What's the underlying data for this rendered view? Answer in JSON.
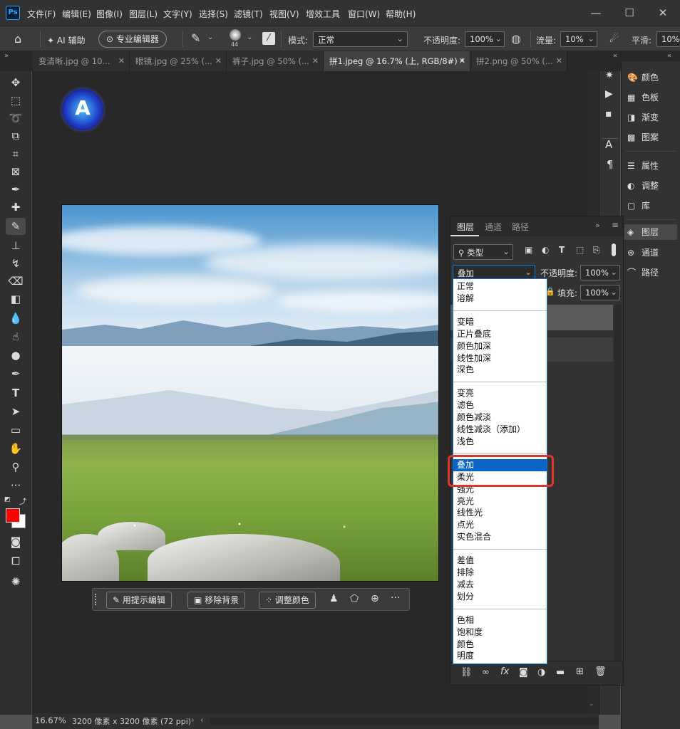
{
  "app": {
    "logo": "Ps"
  },
  "menu": [
    "文件(F)",
    "编辑(E)",
    "图像(I)",
    "图层(L)",
    "文字(Y)",
    "选择(S)",
    "滤镜(T)",
    "视图(V)",
    "增效工具",
    "窗口(W)",
    "帮助(H)"
  ],
  "window_controls": {
    "minimize": "—",
    "maximize": "☐",
    "close": "✕"
  },
  "options": {
    "ai_label": "AI 辅助",
    "pro_editor_label": "专业编辑器",
    "brush_size": "44",
    "mode_label": "模式:",
    "mode_value": "正常",
    "opacity_label": "不透明度:",
    "opacity_value": "100%",
    "flow_label": "流量:",
    "flow_value": "10%",
    "smooth_label": "平滑:",
    "smooth_value": "10%"
  },
  "tabs": [
    {
      "label": "变清晰.jpg @ 10..."
    },
    {
      "label": "眼镜.jpg @ 25% (..."
    },
    {
      "label": "裤子.jpg @ 50% (..."
    },
    {
      "label": "拼1.jpeg @ 16.7% (上, RGB/8#) *"
    },
    {
      "label": "拼2.png @ 50% (..."
    }
  ],
  "right_panels": [
    {
      "icon": "palette-icon",
      "label": "颜色"
    },
    {
      "icon": "grid-icon",
      "label": "色板"
    },
    {
      "icon": "gradient-icon",
      "label": "渐变"
    },
    {
      "icon": "pattern-icon",
      "label": "图案"
    },
    {
      "icon": "sliders-icon",
      "label": "属性"
    },
    {
      "icon": "adjust-icon",
      "label": "调整"
    },
    {
      "icon": "library-icon",
      "label": "库"
    },
    {
      "icon": "layers-icon",
      "label": "图层"
    },
    {
      "icon": "channels-icon",
      "label": "通道"
    },
    {
      "icon": "paths-icon",
      "label": "路径"
    }
  ],
  "layers_panel": {
    "tabs": [
      "图层",
      "通道",
      "路径"
    ],
    "filter_label": "类型",
    "blend_value": "叠加",
    "opacity_label": "不透明度:",
    "opacity_value": "100%",
    "fill_label": "填充:",
    "fill_value": "100%"
  },
  "blend_modes": [
    [
      "正常",
      "溶解"
    ],
    [
      "变暗",
      "正片叠底",
      "颜色加深",
      "线性加深",
      "深色"
    ],
    [
      "变亮",
      "滤色",
      "颜色减淡",
      "线性减淡（添加）",
      "浅色"
    ],
    [
      "叠加",
      "柔光",
      "强光",
      "亮光",
      "线性光",
      "点光",
      "实色混合"
    ],
    [
      "差值",
      "排除",
      "减去",
      "划分"
    ],
    [
      "色相",
      "饱和度",
      "颜色",
      "明度"
    ]
  ],
  "blend_highlighted": "叠加",
  "context_bar": {
    "edit_prompt": "用提示编辑",
    "remove_bg": "移除背景",
    "adjust_color": "调整颜色",
    "more": "···"
  },
  "status": {
    "zoom": "16.67%",
    "doc_info": "3200 像素 x 3200 像素 (72 ppi)"
  },
  "colors": {
    "foreground": "#ff0000",
    "background": "#ffffff",
    "highlight": "#0a64c8",
    "annotation_box": "#e0352b"
  }
}
